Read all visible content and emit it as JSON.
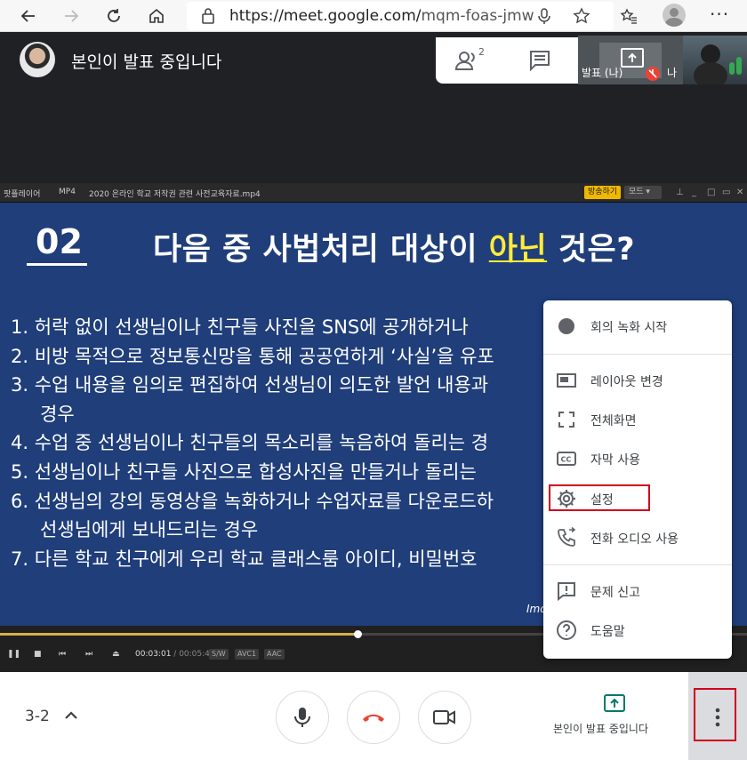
{
  "browser": {
    "url_host": "https://meet.google.com/",
    "url_path": "mqm-foas-jmw"
  },
  "meet": {
    "presenter_title": "본인이 발표 중입니다",
    "people_count": "2",
    "self_label": "발표 (나)",
    "self_label2": "나"
  },
  "player": {
    "app_name": "팟플레이어",
    "format": "MP4",
    "filename": "2020 온라인 학교 저작권 관련 사전교육자료.mp4",
    "broadcast_label": "방송하기",
    "mode_label": "모드",
    "time_current": "00:03:01",
    "time_total": "/ 00:05:44",
    "tags": [
      "S/W",
      "AVC1",
      "AAC"
    ],
    "progress_fraction": 0.478
  },
  "slide": {
    "number": "02",
    "title_pre": "다음 중 사법처리 대상이 ",
    "title_highlight": "아닌",
    "title_post": " 것은?",
    "items": [
      "1.   허락 없이 선생님이나 친구들 사진을 SNS에 공개하거나 ",
      "2.  비방 목적으로 정보통신망을 통해 공공연하게 ‘사실’을 유포",
      "3.  수업 내용을 임의로 편집하여 선생님이 의도한 발언 내용과",
      "경우",
      "4.  수업 중 선생님이나 친구들의 목소리를 녹음하여 돌리는 경",
      "5.  선생님이나 친구들 사진으로 합성사진을 만들거나 돌리는 ",
      "6.  선생님의 강의 동영상을 녹화하거나 수업자료를 다운로드하",
      "선생님에게 보내드리는 경우",
      "7.  다른 학교 친구에게 우리 학교 클래스룸 아이디, 비밀번호 "
    ],
    "footer": "Imc"
  },
  "menu": {
    "items": [
      {
        "label": "회의 녹화 시작",
        "icon": "record-icon"
      },
      {
        "label": "레이아웃 변경",
        "icon": "layout-icon"
      },
      {
        "label": "전체화면",
        "icon": "fullscreen-icon"
      },
      {
        "label": "자막 사용",
        "icon": "captions-icon"
      },
      {
        "label": "설정",
        "icon": "gear-icon"
      },
      {
        "label": "전화 오디오 사용",
        "icon": "phone-audio-icon"
      },
      {
        "label": "문제 신고",
        "icon": "report-icon"
      },
      {
        "label": "도움말",
        "icon": "help-icon"
      }
    ]
  },
  "bottom": {
    "meeting_code": "3-2",
    "present_label": "본인이 발표 중입니다"
  },
  "colors": {
    "meet_dark": "#202124",
    "slide_blue": "#1f3e7a",
    "highlight_yellow": "#ffeb3b",
    "end_call_red": "#ea4335",
    "present_green": "#00796b",
    "annotation_red": "#d0021b"
  }
}
